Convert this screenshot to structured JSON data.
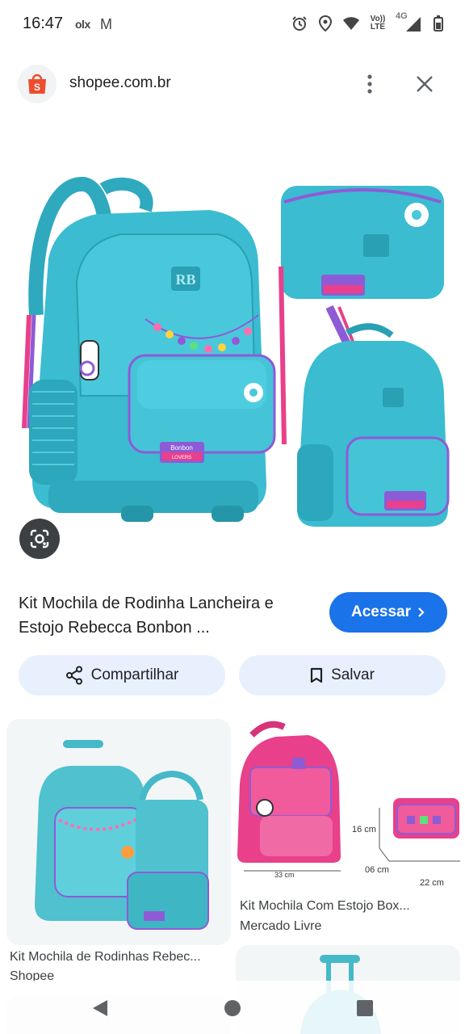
{
  "status_bar": {
    "time": "16:47",
    "app_icon_1": "olx",
    "app_icon_2": "M",
    "lte_line1": "Vo))",
    "lte_line2": "LTE",
    "network": "4G",
    "icons": [
      "alarm-icon",
      "location-icon",
      "wifi-icon",
      "signal-icon",
      "battery-icon"
    ]
  },
  "header": {
    "domain": "shopee.com.br",
    "favicon": "shopee-bag-icon",
    "brand_color": "#ee4d2d"
  },
  "result": {
    "title": "Kit Mochila de Rodinha Lancheira e Estojo Rebecca Bonbon ...",
    "visit_label": "Acessar",
    "visit_color": "#1a73e8"
  },
  "actions": {
    "share_label": "Compartilhar",
    "save_label": "Salvar"
  },
  "related": [
    {
      "title": "Kit Mochila de Rodinhas Rebec...",
      "source": "Shopee"
    },
    {
      "title": "Kit Mochila Com Estojo Box...",
      "source": "Mercado Livre"
    }
  ],
  "dimension_labels": {
    "height": "16 cm",
    "depth": "06 cm",
    "width_bag": "33 cm",
    "width_case": "22 cm"
  },
  "product_badge": {
    "line1": "Bonbon",
    "line2": "LOVERS",
    "monogram": "RB"
  },
  "colors": {
    "teal": "#3bbcd0",
    "pink": "#e8408a",
    "purple": "#8e5bd6"
  }
}
